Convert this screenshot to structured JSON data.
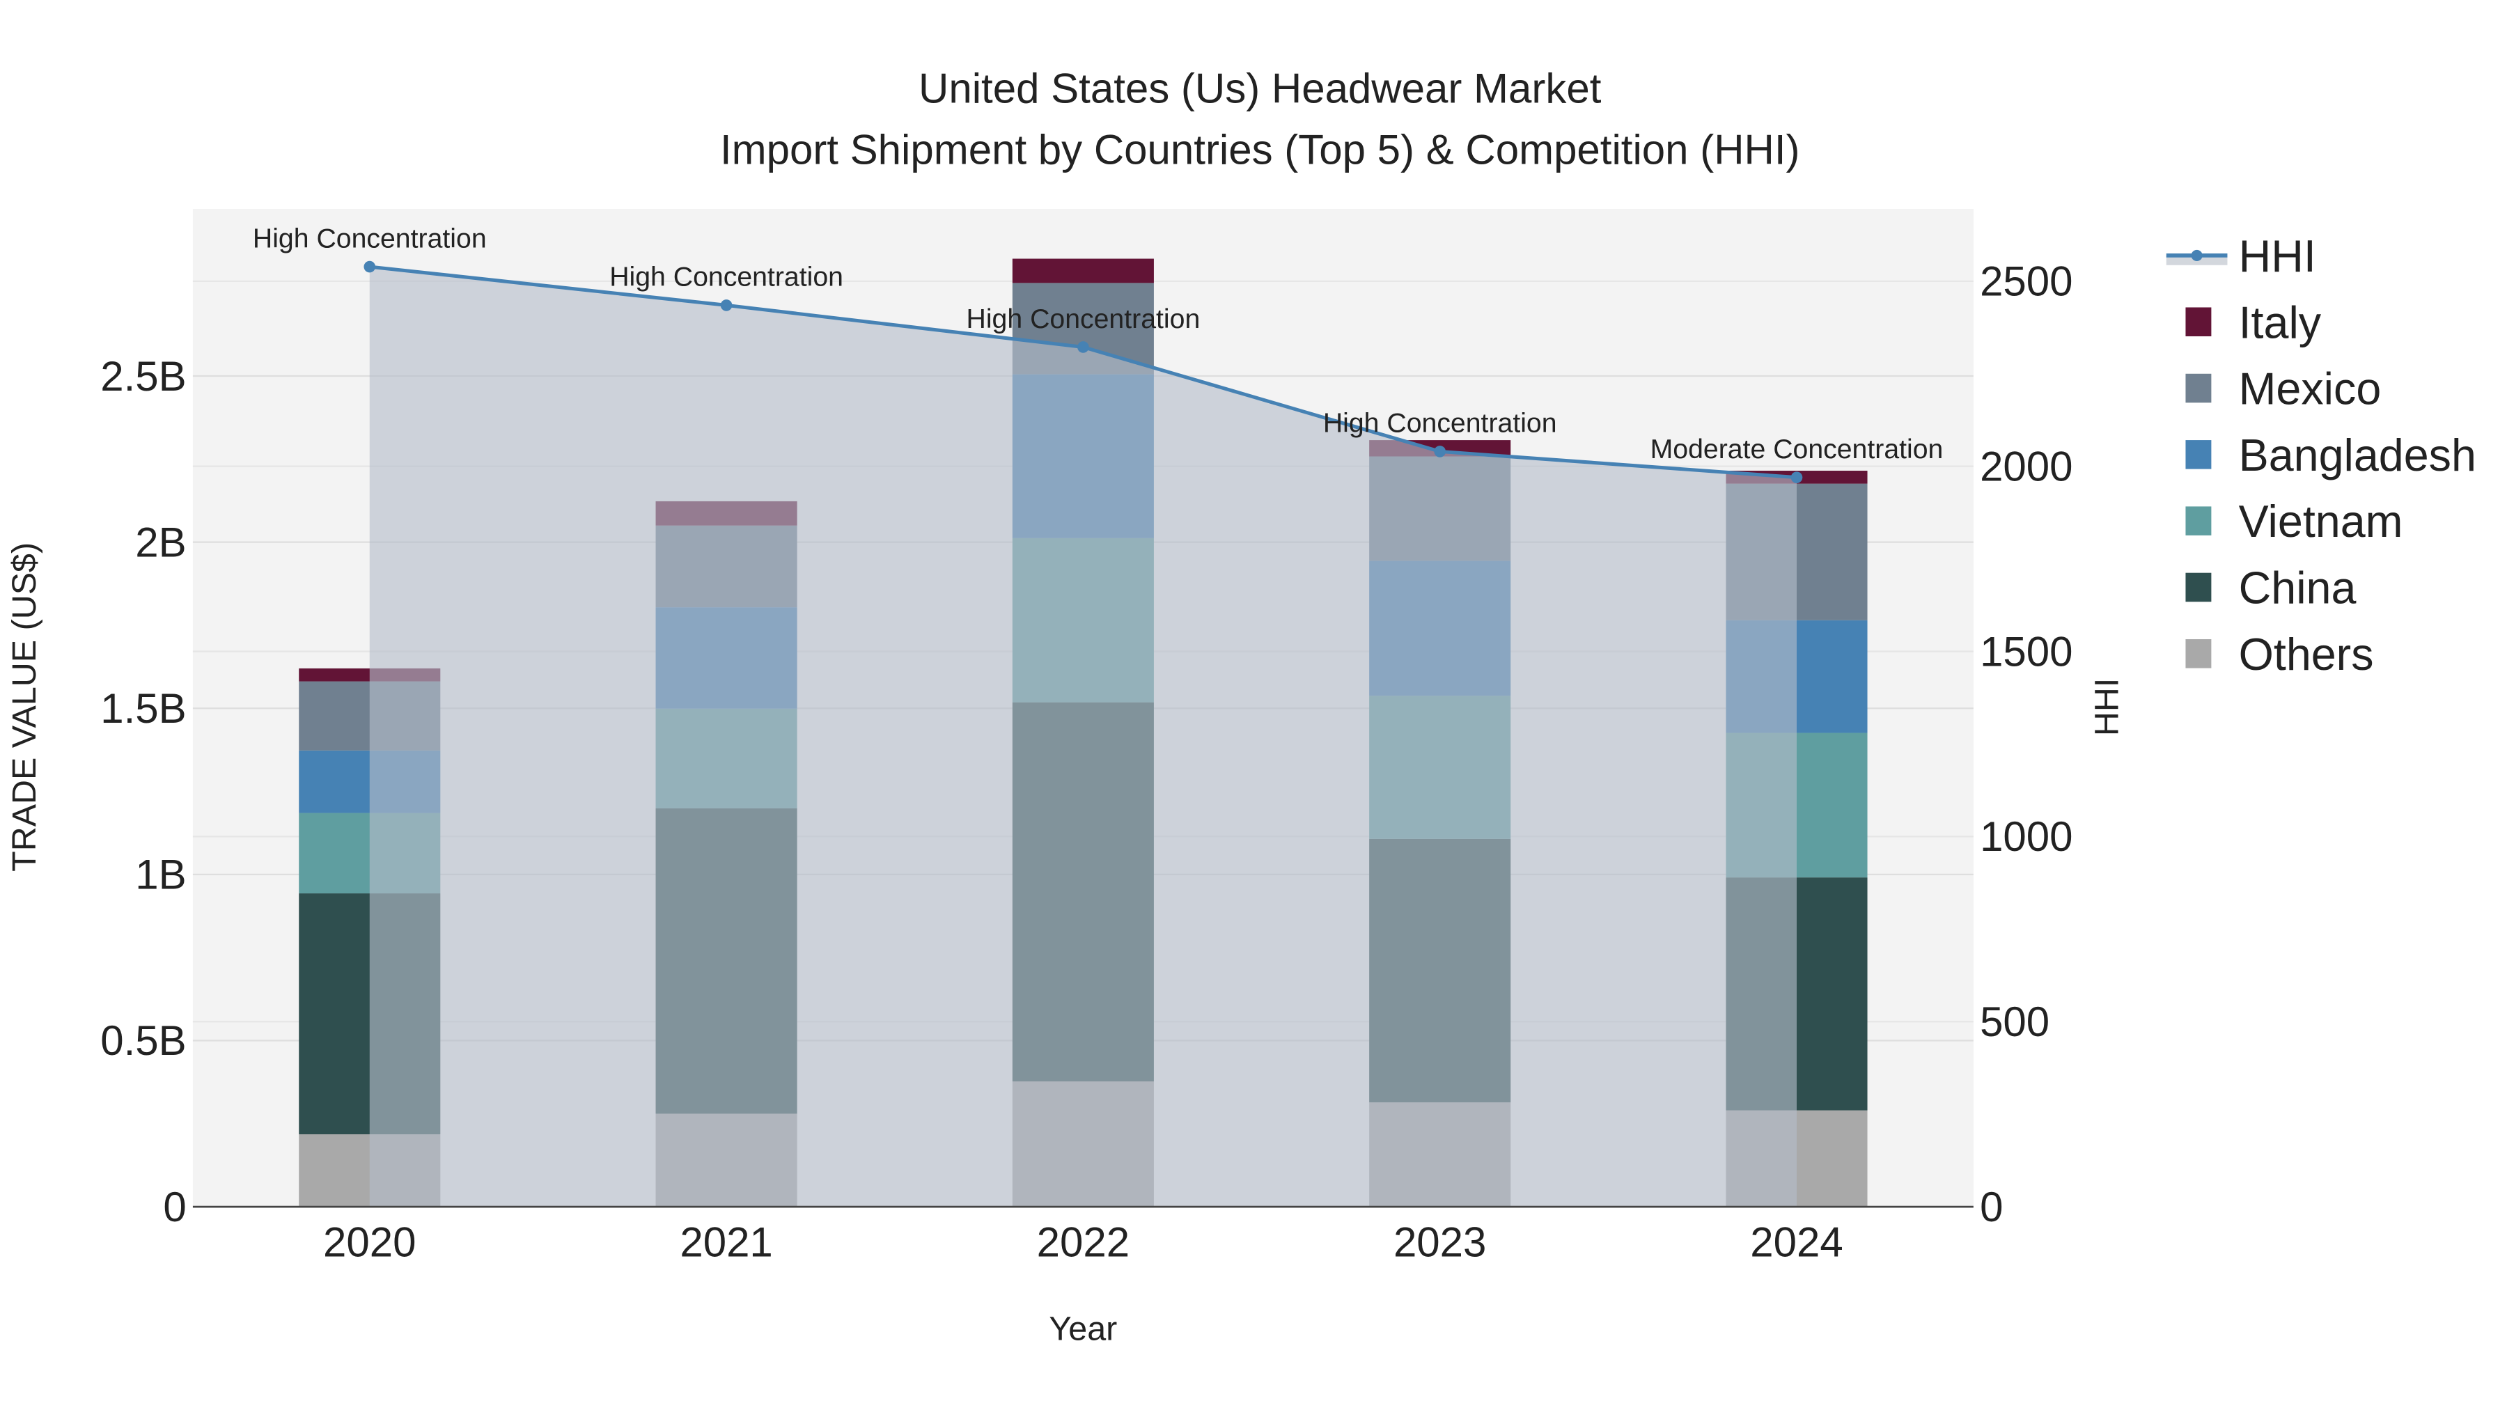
{
  "chart_data": {
    "type": "bar",
    "title_line1": "United States (Us) Headwear Market",
    "title_line2": "Import Shipment by Countries (Top 5) & Competition (HHI)",
    "xlabel": "Year",
    "ylabel": "TRADE VALUE (US$)",
    "y2label": "HHI",
    "categories": [
      "2020",
      "2021",
      "2022",
      "2023",
      "2024"
    ],
    "ylim": [
      0,
      3.0
    ],
    "y_unit": "B US$",
    "y_ticks": [
      0,
      0.5,
      1,
      1.5,
      2,
      2.5
    ],
    "y_tick_labels": [
      "0",
      "0.5B",
      "1B",
      "1.5B",
      "2B",
      "2.5B"
    ],
    "y2lim": [
      0,
      2700
    ],
    "y2_ticks": [
      0,
      500,
      1000,
      1500,
      2000,
      2500
    ],
    "y2_tick_labels": [
      "0",
      "500",
      "1000",
      "1500",
      "2000",
      "2500"
    ],
    "grid": true,
    "legend_position": "right",
    "series": [
      {
        "name": "Others",
        "color": "#a9a9a9",
        "values": [
          0.218,
          0.28,
          0.377,
          0.314,
          0.29
        ]
      },
      {
        "name": "China",
        "color": "#2f4f4f",
        "values": [
          0.725,
          0.919,
          1.141,
          0.793,
          0.701
        ]
      },
      {
        "name": "Vietnam",
        "color": "#5f9ea0",
        "values": [
          0.242,
          0.3,
          0.494,
          0.431,
          0.435
        ]
      },
      {
        "name": "Bangladesh",
        "color": "#4682b4",
        "values": [
          0.188,
          0.305,
          0.493,
          0.406,
          0.339
        ]
      },
      {
        "name": "Mexico",
        "color": "#708090",
        "values": [
          0.208,
          0.246,
          0.275,
          0.314,
          0.411
        ]
      },
      {
        "name": "Italy",
        "color": "#621436",
        "values": [
          0.039,
          0.073,
          0.073,
          0.049,
          0.039
        ]
      }
    ],
    "hhi": {
      "name": "HHI",
      "color": "#4682b4",
      "values": [
        2539,
        2435,
        2322,
        2040,
        1970
      ],
      "annotations": [
        "High Concentration",
        "High Concentration",
        "High Concentration",
        "High Concentration",
        "Moderate Concentration"
      ]
    },
    "legend_order": [
      "HHI",
      "Italy",
      "Mexico",
      "Bangladesh",
      "Vietnam",
      "China",
      "Others"
    ]
  }
}
